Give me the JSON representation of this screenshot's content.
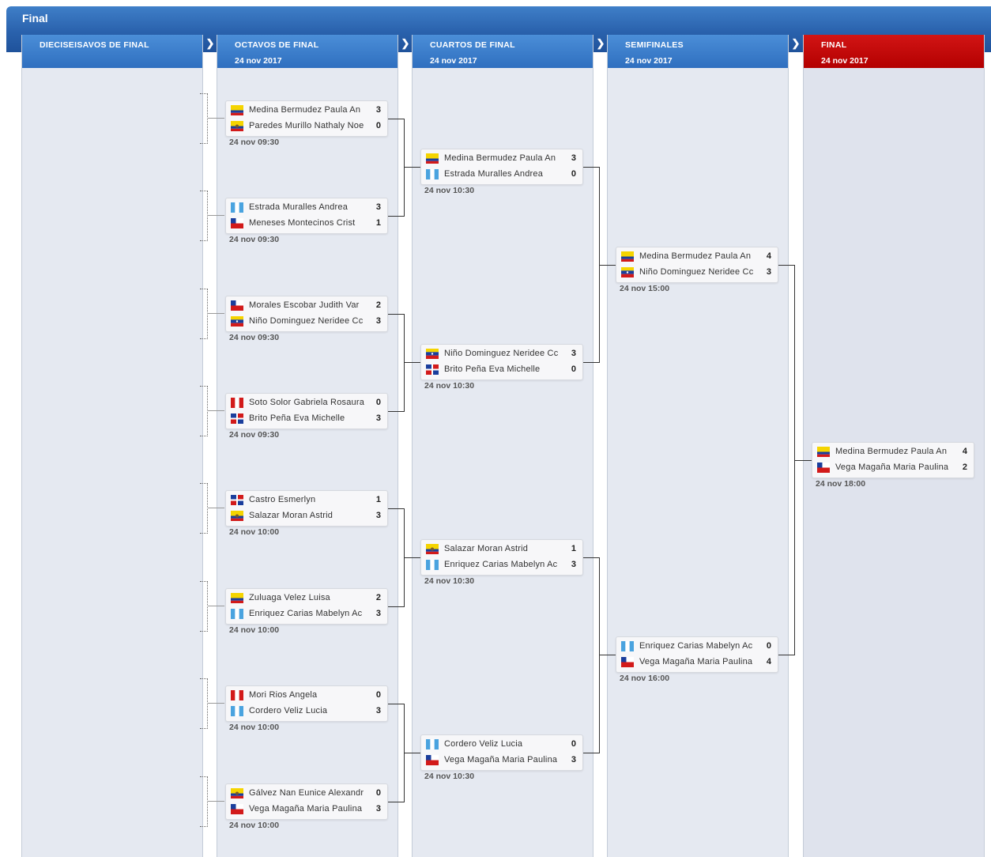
{
  "window": {
    "title": "Final"
  },
  "columns": [
    {
      "name": "DIECISEISAVOS DE FINAL",
      "date": ""
    },
    {
      "name": "OCTAVOS DE FINAL",
      "date": "24 nov 2017"
    },
    {
      "name": "CUARTOS DE FINAL",
      "date": "24 nov 2017"
    },
    {
      "name": "SEMIFINALES",
      "date": "24 nov 2017"
    },
    {
      "name": "FINAL",
      "date": "24 nov 2017"
    }
  ],
  "colors": {
    "header_blue": "#2f6fbf",
    "final_red": "#b30000",
    "column_bg": "#e5e9f1"
  },
  "rounds": {
    "octavos": [
      {
        "time": "24 nov 09:30",
        "p1": {
          "name": "Medina Bermudez Paula An",
          "flag": "colombia",
          "score": "3"
        },
        "p2": {
          "name": "Paredes Murillo Nathaly Noe",
          "flag": "ecuador",
          "score": "0"
        }
      },
      {
        "time": "24 nov 09:30",
        "p1": {
          "name": "Estrada Muralles Andrea",
          "flag": "guatemala",
          "score": "3"
        },
        "p2": {
          "name": "Meneses Montecinos Crist",
          "flag": "chile",
          "score": "1"
        }
      },
      {
        "time": "24 nov 09:30",
        "p1": {
          "name": "Morales Escobar Judith Var",
          "flag": "chile",
          "score": "2"
        },
        "p2": {
          "name": "Niño Dominguez Neridee Cc",
          "flag": "venezuela",
          "score": "3"
        }
      },
      {
        "time": "24 nov 09:30",
        "p1": {
          "name": "Soto Solor Gabriela Rosaura",
          "flag": "peru",
          "score": "0"
        },
        "p2": {
          "name": "Brito Peña Eva Michelle",
          "flag": "dominican",
          "score": "3"
        }
      },
      {
        "time": "24 nov 10:00",
        "p1": {
          "name": "Castro Esmerlyn",
          "flag": "dominican",
          "score": "1"
        },
        "p2": {
          "name": "Salazar Moran Astrid",
          "flag": "ecuador",
          "score": "3"
        }
      },
      {
        "time": "24 nov 10:00",
        "p1": {
          "name": "Zuluaga Velez Luisa",
          "flag": "colombia",
          "score": "2"
        },
        "p2": {
          "name": "Enriquez Carias Mabelyn Ac",
          "flag": "guatemala",
          "score": "3"
        }
      },
      {
        "time": "24 nov 10:00",
        "p1": {
          "name": "Mori Rios Angela",
          "flag": "peru",
          "score": "0"
        },
        "p2": {
          "name": "Cordero Veliz Lucia",
          "flag": "guatemala",
          "score": "3"
        }
      },
      {
        "time": "24 nov 10:00",
        "p1": {
          "name": "Gálvez Nan Eunice Alexandr",
          "flag": "ecuador",
          "score": "0"
        },
        "p2": {
          "name": "Vega Magaña Maria Paulina",
          "flag": "chile",
          "score": "3"
        }
      }
    ],
    "cuartos": [
      {
        "time": "24 nov 10:30",
        "p1": {
          "name": "Medina Bermudez Paula An",
          "flag": "colombia",
          "score": "3"
        },
        "p2": {
          "name": "Estrada Muralles Andrea",
          "flag": "guatemala",
          "score": "0"
        }
      },
      {
        "time": "24 nov 10:30",
        "p1": {
          "name": "Niño Dominguez Neridee Cc",
          "flag": "venezuela",
          "score": "3"
        },
        "p2": {
          "name": "Brito Peña Eva Michelle",
          "flag": "dominican",
          "score": "0"
        }
      },
      {
        "time": "24 nov 10:30",
        "p1": {
          "name": "Salazar Moran Astrid",
          "flag": "ecuador",
          "score": "1"
        },
        "p2": {
          "name": "Enriquez Carias Mabelyn Ac",
          "flag": "guatemala",
          "score": "3"
        }
      },
      {
        "time": "24 nov 10:30",
        "p1": {
          "name": "Cordero Veliz Lucia",
          "flag": "guatemala",
          "score": "0"
        },
        "p2": {
          "name": "Vega Magaña Maria Paulina",
          "flag": "chile",
          "score": "3"
        }
      }
    ],
    "semifinales": [
      {
        "time": "24 nov 15:00",
        "p1": {
          "name": "Medina Bermudez Paula An",
          "flag": "colombia",
          "score": "4"
        },
        "p2": {
          "name": "Niño Dominguez Neridee Cc",
          "flag": "venezuela",
          "score": "3"
        }
      },
      {
        "time": "24 nov 16:00",
        "p1": {
          "name": "Enriquez Carias Mabelyn Ac",
          "flag": "guatemala",
          "score": "0"
        },
        "p2": {
          "name": "Vega Magaña Maria Paulina",
          "flag": "chile",
          "score": "4"
        }
      }
    ],
    "final": [
      {
        "time": "24 nov 18:00",
        "p1": {
          "name": "Medina Bermudez Paula An",
          "flag": "colombia",
          "score": "4"
        },
        "p2": {
          "name": "Vega Magaña Maria Paulina",
          "flag": "chile",
          "score": "2"
        }
      }
    ]
  }
}
